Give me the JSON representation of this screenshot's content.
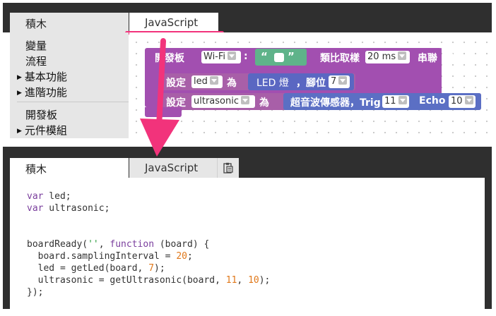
{
  "top": {
    "tabs": {
      "blocks": "積木",
      "javascript": "JavaScript"
    },
    "toolbox": [
      {
        "label": "變量",
        "arrow": false
      },
      {
        "label": "流程",
        "arrow": false
      },
      {
        "label": "基本功能",
        "arrow": true
      },
      {
        "label": "進階功能",
        "arrow": true
      },
      {
        "label": "開發板",
        "arrow": false
      },
      {
        "label": "元件模組",
        "arrow": true
      }
    ],
    "blocks": {
      "board": {
        "label": "開發板",
        "board_type": "Wi-Fi",
        "colon": ":",
        "quote_open": "“",
        "quote_close": "”",
        "sampling_label": "類比取樣",
        "sampling_value": "20 ms",
        "serial_label": "串聯"
      },
      "led": {
        "set_label": "設定",
        "var": "led",
        "as_label": "為",
        "component": "LED 燈",
        "pin_label": "，腳位",
        "pin": "7"
      },
      "ultrasonic": {
        "set_label": "設定",
        "var": "ultrasonic",
        "as_label": "為",
        "component": "超音波傳感器，Trig",
        "trig": "11",
        "echo_label": "Echo",
        "echo": "10"
      }
    }
  },
  "bottom": {
    "tabs": {
      "blocks": "積木",
      "javascript": "JavaScript"
    },
    "copy_icon": "clipboard-icon",
    "code": {
      "line1": [
        "var",
        " led;"
      ],
      "line2": [
        "var",
        " ultrasonic;"
      ],
      "line5a": "boardReady(",
      "line5b": "''",
      "line5c": ", ",
      "line5d": "function",
      "line5e": " (board) {",
      "line6a": "  board.samplingInterval = ",
      "line6b": "20",
      "line6c": ";",
      "line7a": "  led = getLed(board, ",
      "line7b": "7",
      "line7c": ");",
      "line8a": "  ultrasonic = getUltrasonic(board, ",
      "line8b": "11",
      "line8c": ", ",
      "line8d": "10",
      "line8e": ");",
      "line9": "});"
    }
  },
  "colors": {
    "accent_pink": "#f2337b",
    "board_block": "#a24fb0",
    "set_block": "#a85fa8",
    "component_block": "#5b6fc4",
    "led_block": "#5a67c2",
    "text_block": "#5fb38a"
  }
}
